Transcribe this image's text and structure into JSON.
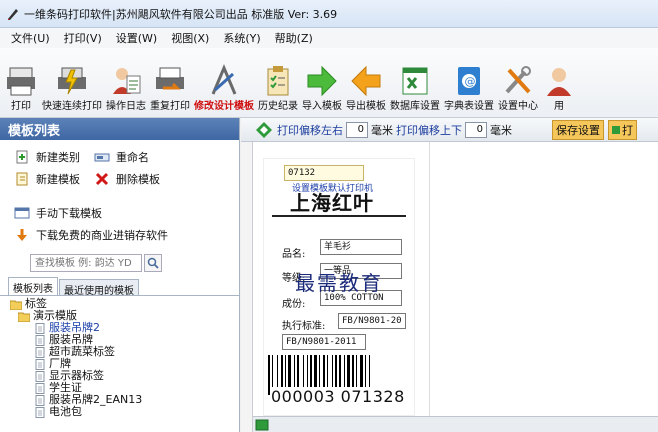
{
  "window": {
    "title": "一维条码打印软件|苏州飓风软件有限公司出品 标准版  Ver: 3.69"
  },
  "menu": [
    "文件(U)",
    "打印(V)",
    "设置(W)",
    "视图(X)",
    "系统(Y)",
    "帮助(Z)"
  ],
  "toolbar": [
    {
      "label": "打印",
      "icon": "printer-icon",
      "highlight": false
    },
    {
      "label": "快速连续打印",
      "icon": "fast-print-icon",
      "highlight": false
    },
    {
      "label": "操作日志",
      "icon": "log-users-icon",
      "highlight": false
    },
    {
      "label": "重复打印",
      "icon": "reprint-icon",
      "highlight": false
    },
    {
      "label": "修改设计模板",
      "icon": "design-icon",
      "highlight": true
    },
    {
      "label": "历史纪录",
      "icon": "clipboard-icon",
      "highlight": false
    },
    {
      "label": "导入模板",
      "icon": "import-arrow-icon",
      "highlight": false
    },
    {
      "label": "导出模板",
      "icon": "export-arrow-icon",
      "highlight": false
    },
    {
      "label": "数据库设置",
      "icon": "excel-icon",
      "highlight": false
    },
    {
      "label": "字典表设置",
      "icon": "dictionary-icon",
      "highlight": false
    },
    {
      "label": "设置中心",
      "icon": "tools-icon",
      "highlight": false
    },
    {
      "label": "用",
      "icon": "user-icon",
      "highlight": false
    }
  ],
  "left_panel": {
    "header": "模板列表",
    "actions": {
      "new_category": "新建类别",
      "rename": "重命名",
      "new_template": "新建模板",
      "delete_template": "删除模板",
      "manual_download": "手动下载模板",
      "download_free": "下载免费的商业进销存软件"
    },
    "search": {
      "placeholder": "查找模板 例: 韵达 YD"
    },
    "tabs": [
      "模板列表",
      "最近使用的模板"
    ],
    "tree": [
      {
        "label": "标签",
        "level": 0,
        "type": "folder",
        "selected": false
      },
      {
        "label": "演示模版",
        "level": 1,
        "type": "folder",
        "selected": false
      },
      {
        "label": "服装吊牌2",
        "level": 2,
        "type": "doc",
        "selected": true
      },
      {
        "label": "服装吊牌",
        "level": 2,
        "type": "doc",
        "selected": false
      },
      {
        "label": "超市蔬菜标签",
        "level": 2,
        "type": "doc",
        "selected": false
      },
      {
        "label": "厂牌",
        "level": 2,
        "type": "doc",
        "selected": false
      },
      {
        "label": "显示器标签",
        "level": 2,
        "type": "doc",
        "selected": false
      },
      {
        "label": "学生证",
        "level": 2,
        "type": "doc",
        "selected": false
      },
      {
        "label": "服装吊牌2_EAN13",
        "level": 2,
        "type": "doc",
        "selected": false
      },
      {
        "label": "电池包",
        "level": 2,
        "type": "doc",
        "selected": false
      }
    ]
  },
  "editor": {
    "offset_lr_label": "打印偏移左右",
    "offset_lr_value": "0",
    "unit": "毫米",
    "offset_ud_label": "打印偏移上下",
    "offset_ud_value": "0",
    "save_label": "保存设置",
    "print_label": "打"
  },
  "label": {
    "code": "07132",
    "watermark_text": "设置模板默认打印机",
    "brand": "上海红叶",
    "name_label": "品名:",
    "name_value": "羊毛衫",
    "grade_label": "等级:",
    "grade_value": "一等品",
    "material_label": "成份:",
    "material_value": "100% COTTON",
    "standard_label": "执行标准:",
    "standard_value": "FB/N9801-20",
    "standard_full": "FB/N9801-2011",
    "barcode_number": "000003 071328"
  },
  "overlay_watermark": "最需教育"
}
